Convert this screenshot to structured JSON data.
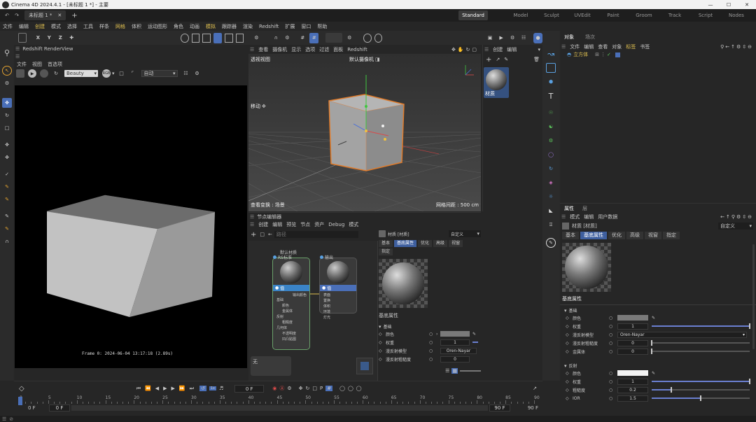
{
  "window_title": "Cinema 4D 2024.4.1 - [未标题 1 *] - 主要",
  "doc_tab": "未标题 1 *",
  "plus": "+",
  "layouts": [
    "Standard",
    "Model",
    "Sculpt",
    "UVEdit",
    "Paint",
    "Groom",
    "Track",
    "Script",
    "Nodes"
  ],
  "menu": [
    "文件",
    "编辑",
    "创建",
    "模式",
    "选择",
    "工具",
    "样条",
    "网格",
    "体积",
    "运动图形",
    "角色",
    "动画",
    "模拟",
    "跟踪器",
    "渲染",
    "Redshift",
    "扩展",
    "窗口",
    "帮助"
  ],
  "axes": [
    "X",
    "Y",
    "Z"
  ],
  "renderview": {
    "title": "Redshift RenderView",
    "menu": [
      "文件",
      "视图",
      "首选项"
    ],
    "aov": "Beauty",
    "aov2": "自动",
    "status": "Frame  0:  2024-06-04  13:17:18  (2.89s)"
  },
  "viewport": {
    "menu": [
      "查看",
      "摄像机",
      "显示",
      "选项",
      "过滤",
      "面板",
      "Redshift"
    ],
    "name": "透视视图",
    "camera": "默认摄像机",
    "mode": "移动",
    "bottom_left": "查看变换 : 场景",
    "bottom_right": "网格间距 : 500 cm"
  },
  "material_mgr": {
    "menu": [
      "创建",
      "编辑"
    ],
    "mat_name": "材质"
  },
  "node_editor": {
    "title": "节点编辑器",
    "menu": [
      "创建",
      "编辑",
      "预览",
      "节点",
      "资产",
      "Debug",
      "模式"
    ],
    "path": "路径",
    "node1": {
      "label": "默认材质",
      "name": "RS标准",
      "header": "值",
      "out": "输出颜色",
      "ports": [
        "基础",
        "颜色",
        "金属体",
        "反射",
        "粗糙度",
        "几何体",
        "不透明度",
        "凹凸贴图"
      ]
    },
    "node2": {
      "name": "输出",
      "header": "值",
      "ports": [
        "表面",
        "置换",
        "体积",
        "环境",
        "灯光"
      ]
    },
    "none_label": "无"
  },
  "mat_panel": {
    "mat_name": "材质 [材质]",
    "preset": "自定义",
    "tabs": [
      "基本",
      "基底属性",
      "优化",
      "高级",
      "视窗",
      "指定"
    ],
    "section": "基底属性",
    "subsection": "基础",
    "rows": [
      {
        "label": "颜色",
        "value": ""
      },
      {
        "label": "权重",
        "value": "1"
      },
      {
        "label": "漫反射模型",
        "value": "Oren-Nayar"
      },
      {
        "label": "漫反射粗糙度",
        "value": "0"
      },
      {
        "label": "金属体",
        "value": "0"
      }
    ]
  },
  "objects": {
    "tabs": [
      "对象",
      "场次"
    ],
    "menu": [
      "文件",
      "编辑",
      "查看",
      "对象",
      "标签",
      "书签"
    ],
    "items": [
      {
        "name": "立方体"
      }
    ]
  },
  "attributes": {
    "tabs": [
      "属性",
      "层"
    ],
    "menu": [
      "模式",
      "编辑",
      "用户数据"
    ],
    "mat_name": "材质 [材质]",
    "preset": "自定义",
    "tabs2": [
      "基本",
      "基底属性",
      "优化",
      "高级",
      "视窗",
      "指定"
    ],
    "section": "基底属性",
    "base_title": "基础",
    "base_rows": [
      {
        "label": "颜色",
        "value": ""
      },
      {
        "label": "权重",
        "value": "1",
        "fill": 1.0
      },
      {
        "label": "漫反射模型",
        "value": "Oren-Nayar"
      },
      {
        "label": "漫反射粗糙度",
        "value": "0",
        "fill": 0.0
      },
      {
        "label": "金属体",
        "value": "0",
        "fill": 0.0
      }
    ],
    "refl_title": "反射",
    "refl_rows": [
      {
        "label": "颜色",
        "value": ""
      },
      {
        "label": "权重",
        "value": "1",
        "fill": 1.0
      },
      {
        "label": "粗糙度",
        "value": "0.2",
        "fill": 0.2
      },
      {
        "label": "IOR",
        "value": "1.5",
        "fill": 0.5
      }
    ]
  },
  "timeline": {
    "frame": "0 F",
    "ticks": [
      "0",
      "5",
      "10",
      "15",
      "20",
      "25",
      "30",
      "35",
      "40",
      "45",
      "50",
      "55",
      "60",
      "65",
      "70",
      "75",
      "80",
      "85",
      "90"
    ],
    "start": "0 F",
    "start2": "0 F",
    "end": "90 F",
    "end2": "90 F"
  },
  "colors": {
    "accent": "#4a6fb8",
    "selection": "#e07b2a",
    "highlight": "#3e5f9f",
    "green": "#5ecb5e"
  }
}
